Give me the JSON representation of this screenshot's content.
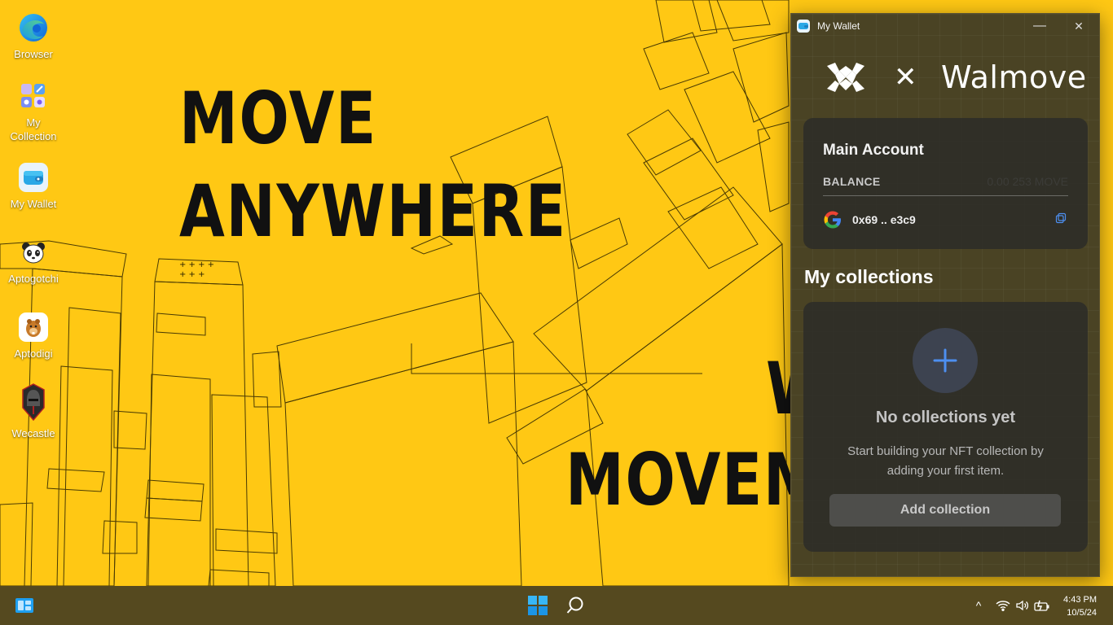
{
  "wallpaper": {
    "headline_line1": "MOVE",
    "headline_line2": "ANYWHERE",
    "secondary_line1": "W",
    "secondary_line2": "MOVEM"
  },
  "desktop_icons": [
    {
      "label": "Browser",
      "icon": "edge-browser-icon"
    },
    {
      "label": "My Collection",
      "icon": "collection-icon"
    },
    {
      "label": "My Wallet",
      "icon": "wallet-icon"
    },
    {
      "label": "Aptogotchi",
      "icon": "panda-icon"
    },
    {
      "label": "Aptodigi",
      "icon": "beaver-icon"
    },
    {
      "label": "Wecastle",
      "icon": "knight-icon"
    }
  ],
  "wallet_window": {
    "title": "My Wallet",
    "minimize_glyph": "—",
    "close_glyph": "✕",
    "brand": {
      "times_glyph": "✕",
      "name": "Walmove"
    },
    "account": {
      "name": "Main Account",
      "balance_label": "BALANCE",
      "balance_value": "0.00 253 MOVE",
      "address": "0x69 .. e3c9",
      "provider_icon": "google-icon",
      "copy_icon": "copy-icon"
    },
    "collections": {
      "section_title": "My collections",
      "empty_title": "No collections yet",
      "empty_description": "Start building your NFT collection by adding your first item.",
      "add_button": "Add collection"
    }
  },
  "taskbar": {
    "time": "4:43 PM",
    "date": "10/5/24",
    "tray_chevron": "^"
  },
  "colors": {
    "wallpaper": "#ffc814",
    "taskbar": "#55491f",
    "wallet_bg": "#4a4324",
    "accent_blue": "#4d8ff0"
  }
}
